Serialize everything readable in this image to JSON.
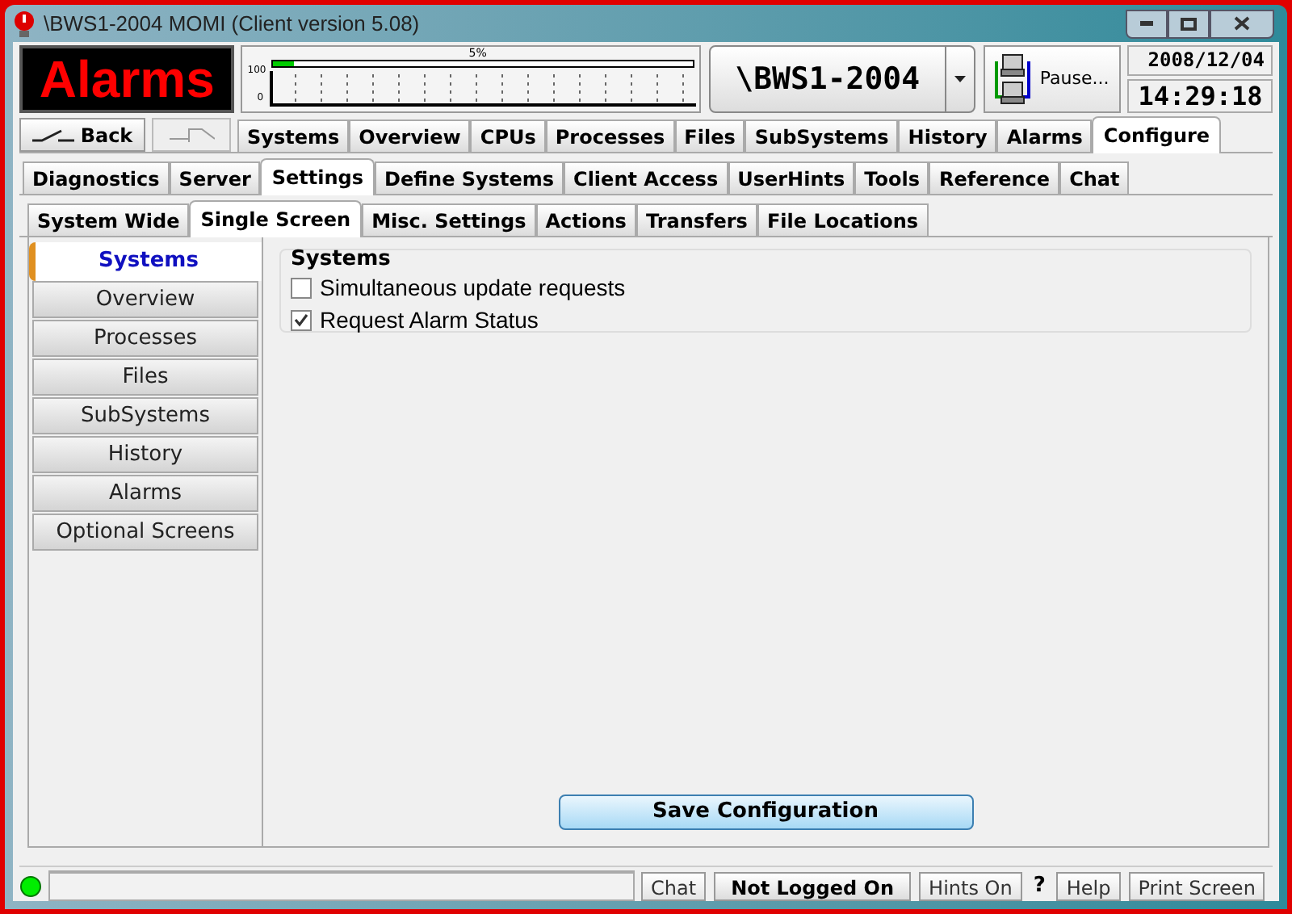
{
  "window": {
    "title": "\\BWS1-2004 MOMI (Client version 5.08)"
  },
  "header": {
    "alarm_label": "Alarms",
    "cpu_meter": {
      "level": 0.05,
      "reading": "5%",
      "axis_max": "100",
      "axis_min": "0"
    },
    "system": "\\BWS1-2004",
    "pause_label": "Pause...",
    "date": "2008/12/04",
    "time": "14:29:18"
  },
  "nav": {
    "back_label": "Back",
    "tabs": [
      {
        "label": "Systems",
        "selected": false
      },
      {
        "label": "Overview",
        "selected": false
      },
      {
        "label": "CPUs",
        "selected": false
      },
      {
        "label": "Processes",
        "selected": false
      },
      {
        "label": "Files",
        "selected": false
      },
      {
        "label": "SubSystems",
        "selected": false
      },
      {
        "label": "History",
        "selected": false
      },
      {
        "label": "Alarms",
        "selected": false
      },
      {
        "label": "Configure",
        "selected": true
      }
    ]
  },
  "config_tabs": [
    {
      "label": "Diagnostics",
      "selected": false
    },
    {
      "label": "Server",
      "selected": false
    },
    {
      "label": "Settings",
      "selected": true
    },
    {
      "label": "Define Systems",
      "selected": false
    },
    {
      "label": "Client Access",
      "selected": false
    },
    {
      "label": "UserHints",
      "selected": false
    },
    {
      "label": "Tools",
      "selected": false
    },
    {
      "label": "Reference",
      "selected": false
    },
    {
      "label": "Chat",
      "selected": false
    }
  ],
  "settings_tabs": [
    {
      "label": "System Wide",
      "selected": false
    },
    {
      "label": "Single Screen",
      "selected": true
    },
    {
      "label": "Misc. Settings",
      "selected": false
    },
    {
      "label": "Actions",
      "selected": false
    },
    {
      "label": "Transfers",
      "selected": false
    },
    {
      "label": "File Locations",
      "selected": false
    }
  ],
  "sidebar": {
    "items": [
      {
        "label": "Systems",
        "selected": true
      },
      {
        "label": "Overview",
        "selected": false
      },
      {
        "label": "Processes",
        "selected": false
      },
      {
        "label": "Files",
        "selected": false
      },
      {
        "label": "SubSystems",
        "selected": false
      },
      {
        "label": "History",
        "selected": false
      },
      {
        "label": "Alarms",
        "selected": false
      },
      {
        "label": "Optional Screens",
        "selected": false
      }
    ]
  },
  "panel": {
    "title": "Systems",
    "options": [
      {
        "label": "Simultaneous update requests",
        "checked": false
      },
      {
        "label": "Request Alarm Status",
        "checked": true
      }
    ],
    "save_button": "Save Configuration"
  },
  "status_bar": {
    "buttons": [
      {
        "label": "Chat",
        "kind": "plain"
      },
      {
        "label": "Not Logged On",
        "kind": "bold"
      },
      {
        "label": "Hints On",
        "kind": "plain"
      },
      {
        "label": "?",
        "kind": "mark"
      },
      {
        "label": "Help",
        "kind": "plain"
      },
      {
        "label": "Print Screen",
        "kind": "plain"
      }
    ]
  }
}
